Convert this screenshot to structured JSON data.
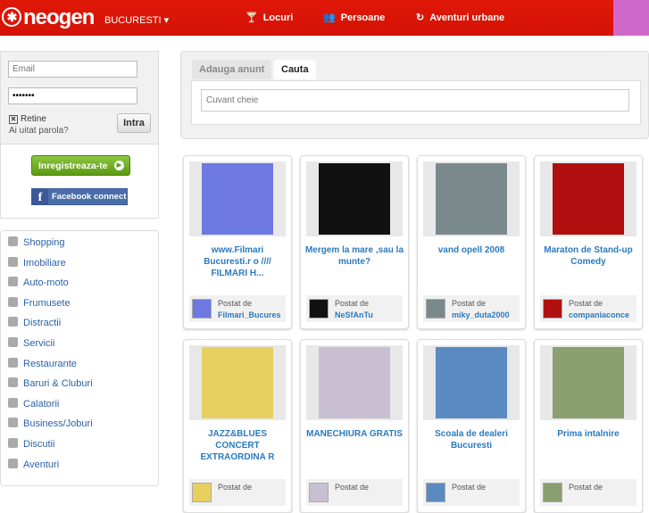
{
  "header": {
    "logo": "neogen",
    "city": "BUCURESTI",
    "nav": [
      {
        "label": "Locuri",
        "icon": "cocktail-icon"
      },
      {
        "label": "Persoane",
        "icon": "people-icon"
      },
      {
        "label": "Aventuri urbane",
        "icon": "aventuri-icon"
      }
    ]
  },
  "login": {
    "email_placeholder": "Email",
    "password_value": "•••••••",
    "remember": "Retine",
    "forgot": "Ai uitat parola?",
    "submit": "Intra",
    "register": "Inregistreaza-te",
    "facebook": "Facebook connect"
  },
  "categories": [
    "Shopping",
    "Imobiliare",
    "Auto-moto",
    "Frumusete",
    "Distractii",
    "Servicii",
    "Restaurante",
    "Baruri & Cluburi",
    "Calatorii",
    "Business/Joburi",
    "Discutii",
    "Aventuri"
  ],
  "search": {
    "tab_add": "Adauga anunt",
    "tab_search": "Cauta",
    "placeholder": "Cuvant cheie"
  },
  "posted_by": "Postat de",
  "cards": [
    {
      "title": "www.Filmari Bucuresti.r o //// FILMARI H...",
      "user": "Filmari_Bucures",
      "img": "#6d78e0"
    },
    {
      "title": "Mergem la mare ,sau la munte?",
      "user": "NeSfAnTu",
      "img": "#111111"
    },
    {
      "title": "vand opell 2008",
      "user": "miky_duta2000",
      "img": "#7a8a8c"
    },
    {
      "title": "Maraton de Stand-up Comedy",
      "user": "companiaconce",
      "img": "#b01010"
    },
    {
      "title": "JAZZ&BLUES CONCERT EXTRAORDINA R",
      "user": "",
      "img": "#e8d060"
    },
    {
      "title": "MANECHIURA GRATIS",
      "user": "",
      "img": "#c8c0d0"
    },
    {
      "title": "Scoala de dealeri Bucuresti",
      "user": "",
      "img": "#5a8ac0"
    },
    {
      "title": "Prima intalnire",
      "user": "",
      "img": "#8aa070"
    }
  ]
}
